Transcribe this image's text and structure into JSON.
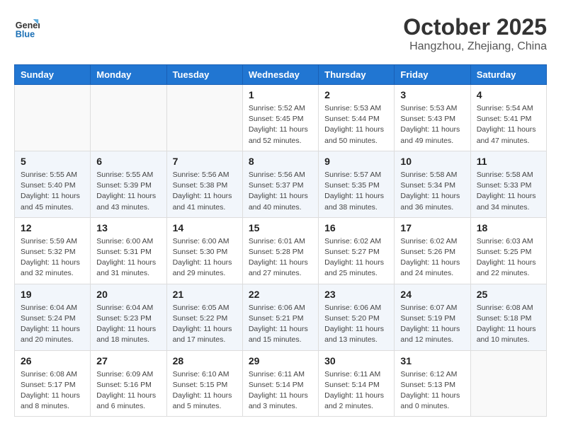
{
  "header": {
    "logo_line1": "General",
    "logo_line2": "Blue",
    "month": "October 2025",
    "location": "Hangzhou, Zhejiang, China"
  },
  "days_of_week": [
    "Sunday",
    "Monday",
    "Tuesday",
    "Wednesday",
    "Thursday",
    "Friday",
    "Saturday"
  ],
  "weeks": [
    {
      "shaded": false,
      "days": [
        {
          "number": "",
          "info": ""
        },
        {
          "number": "",
          "info": ""
        },
        {
          "number": "",
          "info": ""
        },
        {
          "number": "1",
          "info": "Sunrise: 5:52 AM\nSunset: 5:45 PM\nDaylight: 11 hours\nand 52 minutes."
        },
        {
          "number": "2",
          "info": "Sunrise: 5:53 AM\nSunset: 5:44 PM\nDaylight: 11 hours\nand 50 minutes."
        },
        {
          "number": "3",
          "info": "Sunrise: 5:53 AM\nSunset: 5:43 PM\nDaylight: 11 hours\nand 49 minutes."
        },
        {
          "number": "4",
          "info": "Sunrise: 5:54 AM\nSunset: 5:41 PM\nDaylight: 11 hours\nand 47 minutes."
        }
      ]
    },
    {
      "shaded": true,
      "days": [
        {
          "number": "5",
          "info": "Sunrise: 5:55 AM\nSunset: 5:40 PM\nDaylight: 11 hours\nand 45 minutes."
        },
        {
          "number": "6",
          "info": "Sunrise: 5:55 AM\nSunset: 5:39 PM\nDaylight: 11 hours\nand 43 minutes."
        },
        {
          "number": "7",
          "info": "Sunrise: 5:56 AM\nSunset: 5:38 PM\nDaylight: 11 hours\nand 41 minutes."
        },
        {
          "number": "8",
          "info": "Sunrise: 5:56 AM\nSunset: 5:37 PM\nDaylight: 11 hours\nand 40 minutes."
        },
        {
          "number": "9",
          "info": "Sunrise: 5:57 AM\nSunset: 5:35 PM\nDaylight: 11 hours\nand 38 minutes."
        },
        {
          "number": "10",
          "info": "Sunrise: 5:58 AM\nSunset: 5:34 PM\nDaylight: 11 hours\nand 36 minutes."
        },
        {
          "number": "11",
          "info": "Sunrise: 5:58 AM\nSunset: 5:33 PM\nDaylight: 11 hours\nand 34 minutes."
        }
      ]
    },
    {
      "shaded": false,
      "days": [
        {
          "number": "12",
          "info": "Sunrise: 5:59 AM\nSunset: 5:32 PM\nDaylight: 11 hours\nand 32 minutes."
        },
        {
          "number": "13",
          "info": "Sunrise: 6:00 AM\nSunset: 5:31 PM\nDaylight: 11 hours\nand 31 minutes."
        },
        {
          "number": "14",
          "info": "Sunrise: 6:00 AM\nSunset: 5:30 PM\nDaylight: 11 hours\nand 29 minutes."
        },
        {
          "number": "15",
          "info": "Sunrise: 6:01 AM\nSunset: 5:28 PM\nDaylight: 11 hours\nand 27 minutes."
        },
        {
          "number": "16",
          "info": "Sunrise: 6:02 AM\nSunset: 5:27 PM\nDaylight: 11 hours\nand 25 minutes."
        },
        {
          "number": "17",
          "info": "Sunrise: 6:02 AM\nSunset: 5:26 PM\nDaylight: 11 hours\nand 24 minutes."
        },
        {
          "number": "18",
          "info": "Sunrise: 6:03 AM\nSunset: 5:25 PM\nDaylight: 11 hours\nand 22 minutes."
        }
      ]
    },
    {
      "shaded": true,
      "days": [
        {
          "number": "19",
          "info": "Sunrise: 6:04 AM\nSunset: 5:24 PM\nDaylight: 11 hours\nand 20 minutes."
        },
        {
          "number": "20",
          "info": "Sunrise: 6:04 AM\nSunset: 5:23 PM\nDaylight: 11 hours\nand 18 minutes."
        },
        {
          "number": "21",
          "info": "Sunrise: 6:05 AM\nSunset: 5:22 PM\nDaylight: 11 hours\nand 17 minutes."
        },
        {
          "number": "22",
          "info": "Sunrise: 6:06 AM\nSunset: 5:21 PM\nDaylight: 11 hours\nand 15 minutes."
        },
        {
          "number": "23",
          "info": "Sunrise: 6:06 AM\nSunset: 5:20 PM\nDaylight: 11 hours\nand 13 minutes."
        },
        {
          "number": "24",
          "info": "Sunrise: 6:07 AM\nSunset: 5:19 PM\nDaylight: 11 hours\nand 12 minutes."
        },
        {
          "number": "25",
          "info": "Sunrise: 6:08 AM\nSunset: 5:18 PM\nDaylight: 11 hours\nand 10 minutes."
        }
      ]
    },
    {
      "shaded": false,
      "days": [
        {
          "number": "26",
          "info": "Sunrise: 6:08 AM\nSunset: 5:17 PM\nDaylight: 11 hours\nand 8 minutes."
        },
        {
          "number": "27",
          "info": "Sunrise: 6:09 AM\nSunset: 5:16 PM\nDaylight: 11 hours\nand 6 minutes."
        },
        {
          "number": "28",
          "info": "Sunrise: 6:10 AM\nSunset: 5:15 PM\nDaylight: 11 hours\nand 5 minutes."
        },
        {
          "number": "29",
          "info": "Sunrise: 6:11 AM\nSunset: 5:14 PM\nDaylight: 11 hours\nand 3 minutes."
        },
        {
          "number": "30",
          "info": "Sunrise: 6:11 AM\nSunset: 5:14 PM\nDaylight: 11 hours\nand 2 minutes."
        },
        {
          "number": "31",
          "info": "Sunrise: 6:12 AM\nSunset: 5:13 PM\nDaylight: 11 hours\nand 0 minutes."
        },
        {
          "number": "",
          "info": ""
        }
      ]
    }
  ]
}
